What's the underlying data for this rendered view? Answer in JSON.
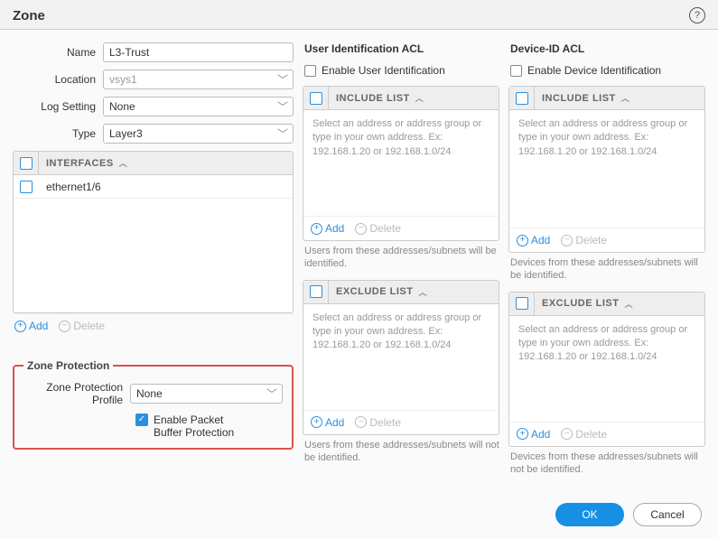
{
  "header": {
    "title": "Zone"
  },
  "form": {
    "name_label": "Name",
    "name_value": "L3-Trust",
    "location_label": "Location",
    "location_value": "vsys1",
    "log_label": "Log Setting",
    "log_value": "None",
    "type_label": "Type",
    "type_value": "Layer3"
  },
  "interfaces": {
    "header": "INTERFACES",
    "rows": [
      "ethernet1/6"
    ]
  },
  "zone_protection": {
    "legend": "Zone Protection",
    "profile_label": "Zone Protection Profile",
    "profile_value": "None",
    "pbp_label": "Enable Packet Buffer Protection",
    "pbp_checked": true
  },
  "user_acl": {
    "title": "User Identification ACL",
    "enable_label": "Enable User Identification",
    "include_header": "INCLUDE LIST",
    "exclude_header": "EXCLUDE LIST",
    "placeholder": "Select an address or address group or type in your own address. Ex: 192.168.1.20 or 192.168.1.0/24",
    "include_note": "Users from these addresses/subnets will be identified.",
    "exclude_note": "Users from these addresses/subnets will not be identified."
  },
  "device_acl": {
    "title": "Device-ID ACL",
    "enable_label": "Enable Device Identification",
    "include_header": "INCLUDE LIST",
    "exclude_header": "EXCLUDE LIST",
    "placeholder": "Select an address or address group or type in your own address. Ex: 192.168.1.20 or 192.168.1.0/24",
    "include_note": "Devices from these addresses/subnets will be identified.",
    "exclude_note": "Devices from these addresses/subnets will not be identified."
  },
  "actions": {
    "add": "Add",
    "delete": "Delete"
  },
  "footer": {
    "ok": "OK",
    "cancel": "Cancel"
  }
}
